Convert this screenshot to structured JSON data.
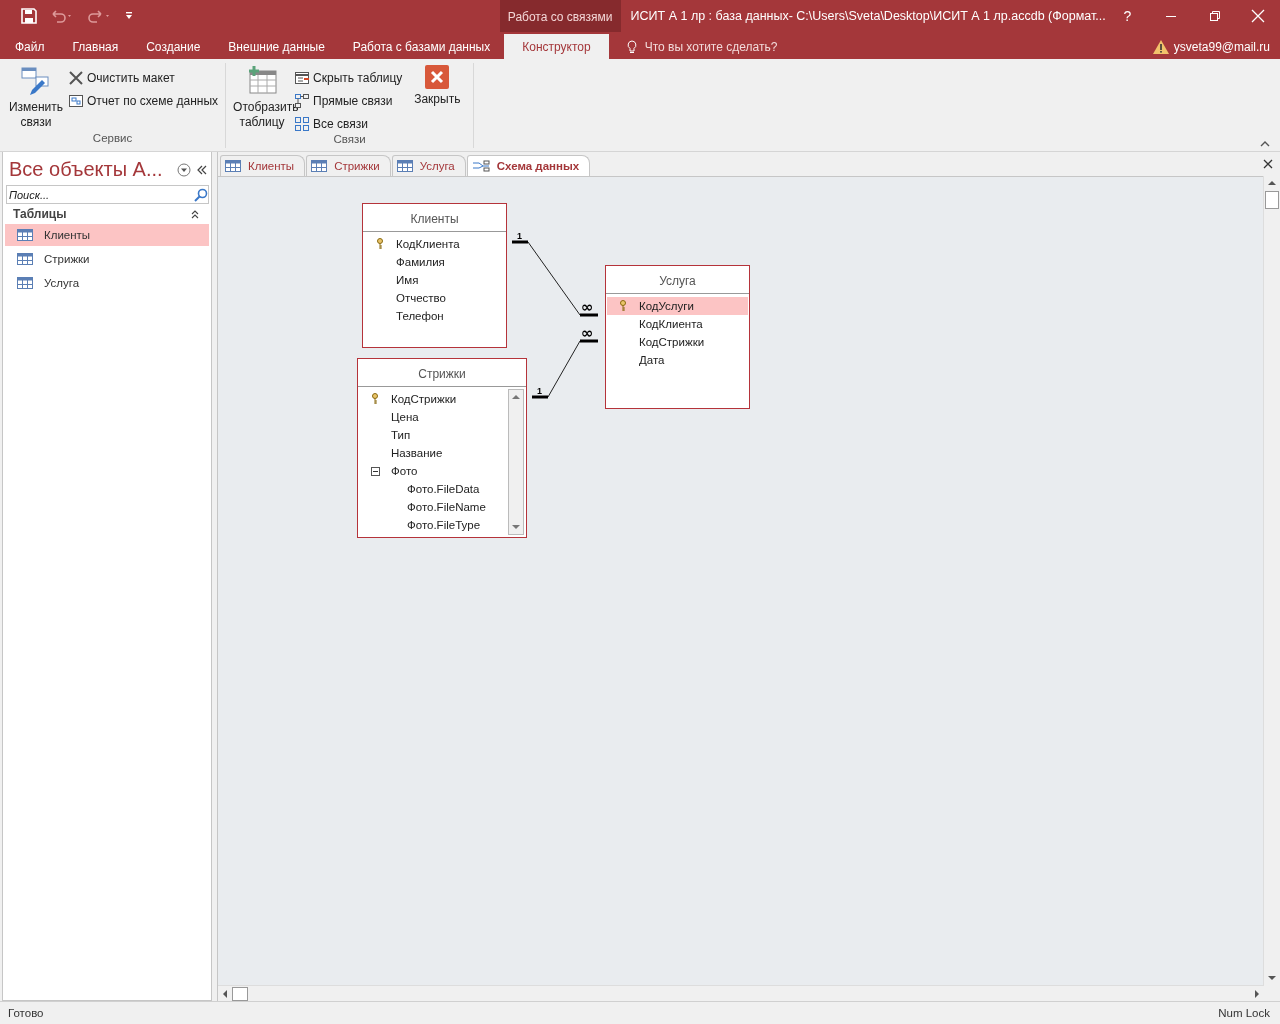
{
  "title_bar": {
    "context_label": "Работа со связями",
    "title": "ИСИТ А 1 лр : база данных- C:\\Users\\Sveta\\Desktop\\ИСИТ А 1 лр.accdb (Формат...",
    "help": "?"
  },
  "ribbon_tabs": [
    {
      "label": "Файл",
      "selected": false
    },
    {
      "label": "Главная",
      "selected": false
    },
    {
      "label": "Создание",
      "selected": false
    },
    {
      "label": "Внешние данные",
      "selected": false
    },
    {
      "label": "Работа с базами данных",
      "selected": false
    },
    {
      "label": "Конструктор",
      "selected": true
    }
  ],
  "tell_me": {
    "placeholder": "Что вы хотите сделать?"
  },
  "account": "ysveta99@mail.ru",
  "ribbon_groups": [
    {
      "label": "Сервис",
      "buttons": [
        {
          "label": "Изменить связи",
          "kind": "edit-relations"
        },
        {
          "label": "Очистить макет",
          "kind": "clear"
        },
        {
          "label": "Отчет по схеме данных",
          "kind": "report"
        }
      ]
    },
    {
      "label": "Связи",
      "buttons": [
        {
          "label": "Отобразить таблицу",
          "kind": "show-table"
        },
        {
          "label": "Скрыть таблицу",
          "kind": "hide-table"
        },
        {
          "label": "Прямые связи",
          "kind": "direct"
        },
        {
          "label": "Все связи",
          "kind": "all"
        },
        {
          "label": "Закрыть",
          "kind": "close"
        }
      ]
    }
  ],
  "nav_pane": {
    "title": "Все объекты A...",
    "search": {
      "placeholder": "Поиск..."
    },
    "section": "Таблицы",
    "items": [
      {
        "label": "Клиенты",
        "selected": true
      },
      {
        "label": "Стрижки",
        "selected": false
      },
      {
        "label": "Услуга",
        "selected": false
      }
    ]
  },
  "doc_tabs": [
    {
      "label": "Клиенты",
      "kind": "table",
      "selected": false
    },
    {
      "label": "Стрижки",
      "kind": "table",
      "selected": false
    },
    {
      "label": "Услуга",
      "kind": "table",
      "selected": false
    },
    {
      "label": "Схема данных",
      "kind": "schema",
      "selected": true
    }
  ],
  "diagram": {
    "tables": [
      {
        "name": "Клиенты",
        "fields": [
          {
            "name": "КодКлиента",
            "key": true,
            "selected": false
          },
          {
            "name": "Фамилия",
            "key": false,
            "selected": false
          },
          {
            "name": "Имя",
            "key": false,
            "selected": false
          },
          {
            "name": "Отчество",
            "key": false,
            "selected": false
          },
          {
            "name": "Телефон",
            "key": false,
            "selected": false
          }
        ]
      },
      {
        "name": "Стрижки",
        "fields": [
          {
            "name": "КодСтрижки",
            "key": true,
            "selected": false
          },
          {
            "name": "Цена",
            "key": false,
            "selected": false
          },
          {
            "name": "Тип",
            "key": false,
            "selected": false
          },
          {
            "name": "Название",
            "key": false,
            "selected": false
          },
          {
            "name": "Фото",
            "key": false,
            "selected": false,
            "expanded": true,
            "children": [
              {
                "name": "Фото.FileData"
              },
              {
                "name": "Фото.FileName"
              },
              {
                "name": "Фото.FileType"
              }
            ]
          }
        ]
      },
      {
        "name": "Услуга",
        "fields": [
          {
            "name": "КодУслуги",
            "key": true,
            "selected": true
          },
          {
            "name": "КодКлиента",
            "key": false,
            "selected": false
          },
          {
            "name": "КодСтрижки",
            "key": false,
            "selected": false
          },
          {
            "name": "Дата",
            "key": false,
            "selected": false
          }
        ]
      }
    ],
    "relationships": [
      {
        "one_label": "1",
        "many_label": "∞"
      },
      {
        "one_label": "1",
        "many_label": "∞"
      }
    ]
  },
  "status_bar": {
    "left": "Готово",
    "right": "Num Lock"
  }
}
